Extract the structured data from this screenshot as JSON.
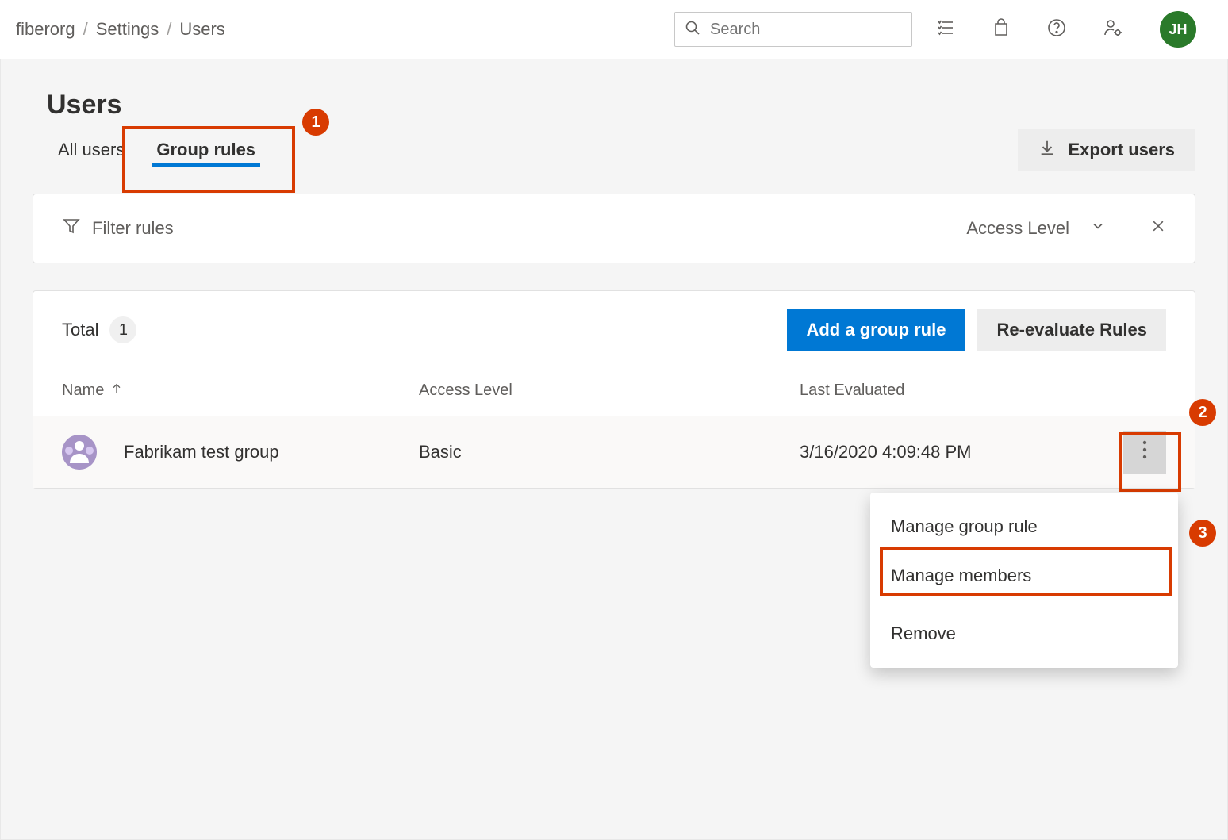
{
  "breadcrumb": {
    "org": "fiberorg",
    "settings": "Settings",
    "users": "Users"
  },
  "search": {
    "placeholder": "Search"
  },
  "avatar": {
    "initials": "JH"
  },
  "page": {
    "title": "Users"
  },
  "tabs": {
    "all_users": "All users",
    "group_rules": "Group rules"
  },
  "export_button": "Export users",
  "filter": {
    "placeholder": "Filter rules",
    "chip": "Access Level"
  },
  "panel": {
    "total_label": "Total",
    "total_count": "1",
    "add_rule_label": "Add a group rule",
    "reeval_label": "Re-evaluate Rules"
  },
  "columns": {
    "name": "Name",
    "access": "Access Level",
    "evaluated": "Last Evaluated"
  },
  "row": {
    "name": "Fabrikam test group",
    "access": "Basic",
    "evaluated": "3/16/2020 4:09:48 PM"
  },
  "menu": {
    "manage_rule": "Manage group rule",
    "manage_members": "Manage members",
    "remove": "Remove"
  },
  "callouts": {
    "one": "1",
    "two": "2",
    "three": "3"
  }
}
